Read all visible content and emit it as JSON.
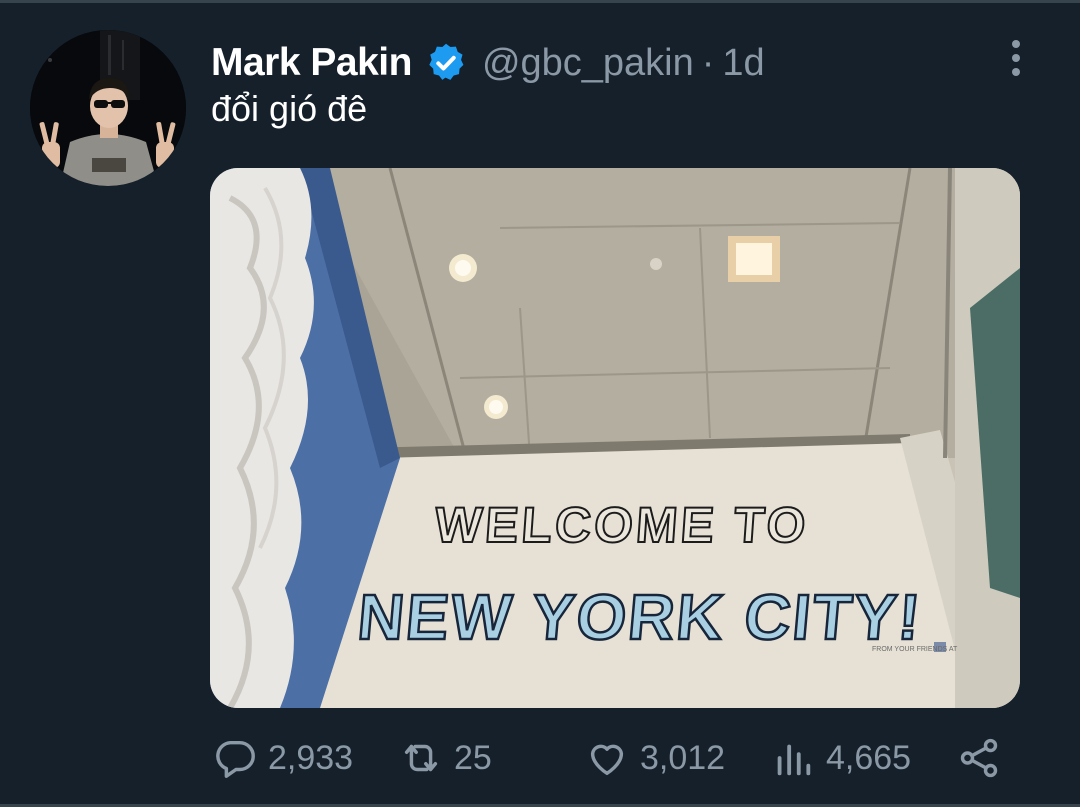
{
  "tweet": {
    "author_name": "Mark Pakin",
    "verified": true,
    "handle": "@gbc_pakin",
    "separator": "·",
    "time": "1d",
    "text": "đổi gió đê"
  },
  "media": {
    "sign_line_1": "WELCOME TO",
    "sign_line_2": "NEW YORK CITY!",
    "sign_small": "FROM YOUR FRIENDS AT"
  },
  "actions": {
    "replies": "2,933",
    "retweets": "25",
    "likes": "3,012",
    "views": "4,665"
  },
  "icons": {
    "verified": "verified-badge-icon",
    "more": "more-vertical-icon",
    "reply": "reply-icon",
    "retweet": "retweet-icon",
    "like": "heart-icon",
    "views": "analytics-icon",
    "share": "share-icon"
  },
  "colors": {
    "background": "#15202b",
    "text_primary": "#ffffff",
    "text_secondary": "#8b98a5",
    "verified_blue": "#1d9bf0"
  }
}
